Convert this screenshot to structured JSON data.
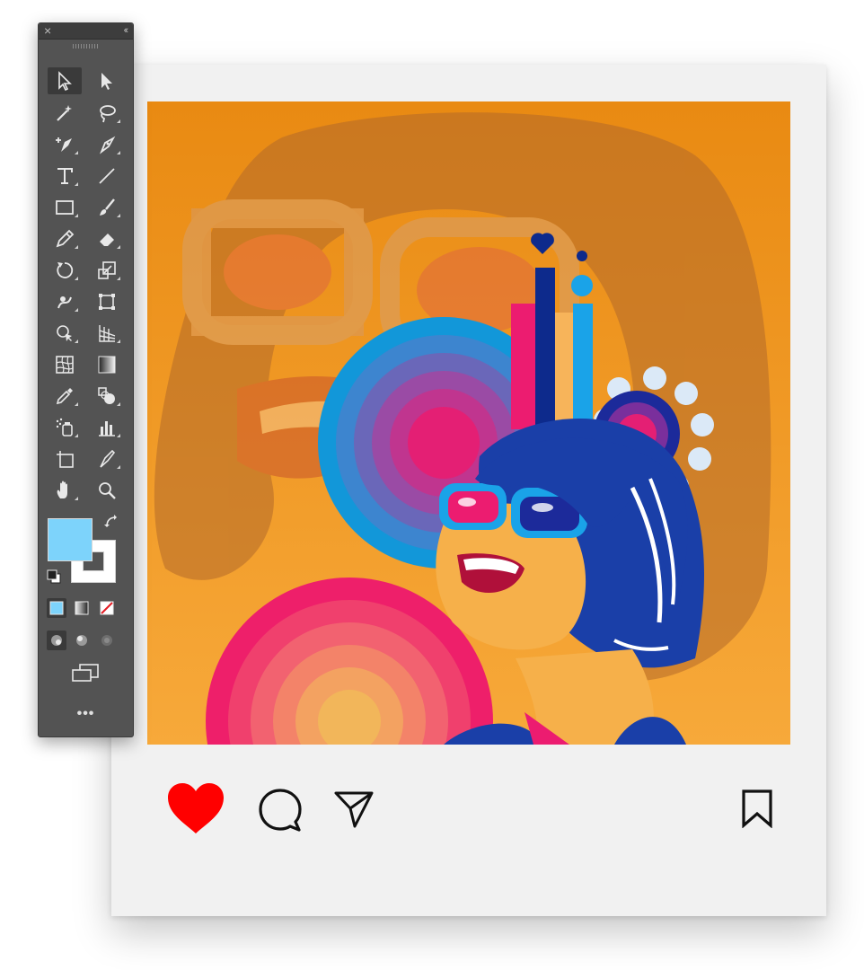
{
  "app": {
    "panel": "tools",
    "close_glyph": "×",
    "collapse_glyph": "‹‹",
    "more_glyph": "•••"
  },
  "tools": [
    {
      "name": "selection-tool",
      "icon": "arrow-outline-icon",
      "active": true
    },
    {
      "name": "direct-selection-tool",
      "icon": "arrow-solid-icon"
    },
    {
      "name": "magic-wand-tool",
      "icon": "magic-wand-icon"
    },
    {
      "name": "lasso-tool",
      "icon": "lasso-icon"
    },
    {
      "name": "add-anchor-tool",
      "icon": "pen-plus-icon"
    },
    {
      "name": "curvature-tool",
      "icon": "curvature-pen-icon"
    },
    {
      "name": "type-tool",
      "icon": "type-icon"
    },
    {
      "name": "line-tool",
      "icon": "line-icon"
    },
    {
      "name": "rectangle-tool",
      "icon": "rectangle-icon"
    },
    {
      "name": "paintbrush-tool",
      "icon": "brush-icon"
    },
    {
      "name": "shaper-tool",
      "icon": "pencil-icon"
    },
    {
      "name": "eraser-tool",
      "icon": "eraser-icon"
    },
    {
      "name": "rotate-tool",
      "icon": "rotate-icon"
    },
    {
      "name": "scale-tool",
      "icon": "scale-icon"
    },
    {
      "name": "warp-tool",
      "icon": "warp-icon"
    },
    {
      "name": "free-transform-tool",
      "icon": "free-transform-icon"
    },
    {
      "name": "shape-builder-tool",
      "icon": "shape-builder-icon"
    },
    {
      "name": "perspective-grid-tool",
      "icon": "perspective-grid-icon"
    },
    {
      "name": "mesh-tool",
      "icon": "mesh-icon"
    },
    {
      "name": "gradient-tool",
      "icon": "gradient-icon"
    },
    {
      "name": "eyedropper-tool",
      "icon": "eyedropper-icon"
    },
    {
      "name": "blend-tool",
      "icon": "blend-icon"
    },
    {
      "name": "symbol-sprayer-tool",
      "icon": "symbol-sprayer-icon"
    },
    {
      "name": "column-graph-tool",
      "icon": "column-graph-icon"
    },
    {
      "name": "artboard-tool",
      "icon": "artboard-icon"
    },
    {
      "name": "slice-tool",
      "icon": "slice-icon"
    },
    {
      "name": "hand-tool",
      "icon": "hand-icon"
    },
    {
      "name": "zoom-tool",
      "icon": "zoom-icon"
    }
  ],
  "colors": {
    "fill": "#7dd3fb",
    "stroke": "none",
    "panel_bg": "#535353",
    "like_red": "#ff0000",
    "card_bg": "#f1f1f1"
  },
  "post": {
    "liked": true,
    "actions": [
      "heart-icon",
      "comment-icon",
      "share-icon",
      "bookmark-icon"
    ]
  }
}
